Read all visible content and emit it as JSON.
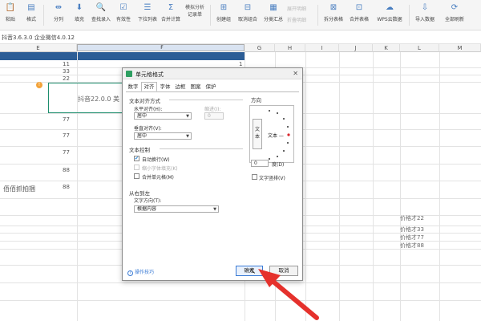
{
  "ribbon": {
    "buttons": [
      {
        "label": "粘贴",
        "icon": "paste-icon"
      },
      {
        "label": "格式",
        "icon": "format-icon"
      },
      {
        "label": "分列",
        "icon": "split-column-icon"
      },
      {
        "label": "填充",
        "icon": "fill-icon"
      },
      {
        "label": "查找录入",
        "icon": "find-entry-icon"
      },
      {
        "label": "有效性",
        "icon": "validity-icon"
      },
      {
        "label": "下拉列表",
        "icon": "dropdown-list-icon"
      },
      {
        "label": "合并计算",
        "icon": "merge-calc-icon"
      },
      {
        "label": "记录单",
        "icon": "record-form-icon"
      },
      {
        "label": "创建组",
        "icon": "create-group-icon"
      },
      {
        "label": "取消组合",
        "icon": "ungroup-icon"
      },
      {
        "label": "分类汇总",
        "icon": "subtotal-icon"
      },
      {
        "label": "拆分表格",
        "icon": "split-table-icon"
      },
      {
        "label": "合并表格",
        "icon": "merge-table-icon"
      },
      {
        "label": "WPS云数据",
        "icon": "cloud-data-icon"
      },
      {
        "label": "导入数据",
        "icon": "import-data-icon"
      },
      {
        "label": "全部刷新",
        "icon": "refresh-icon"
      }
    ],
    "small_items": {
      "simulate": "模拟分析",
      "show_detail": "展开明细",
      "hide_detail": "折叠明细"
    }
  },
  "formula_bar": {
    "content": "抖音3.6.3.0 企业微信4.0.12"
  },
  "columns": [
    "E",
    "F",
    "G",
    "H",
    "I",
    "J",
    "K",
    "L",
    "M"
  ],
  "cells": {
    "r1": "11",
    "r2": "33",
    "r3": "22",
    "r5": "77",
    "r6": "77",
    "r7": "77",
    "r8": "88",
    "r9": "88",
    "f1": "1",
    "bottom_left": "佰佰抓拍捆",
    "selected": "抖音22.0.0 美",
    "right_cells": [
      "价格才22",
      "价格才33",
      "价格才77",
      "价格才88"
    ]
  },
  "dialog": {
    "title": "单元格格式",
    "tabs": [
      "数字",
      "对齐",
      "字体",
      "边框",
      "图案",
      "保护"
    ],
    "active_tab": "对齐",
    "text_align": {
      "group": "文本对齐方式",
      "horizontal_label": "水平对齐(H):",
      "horizontal_value": "居中",
      "indent_label": "缩进(I):",
      "indent_value": "0",
      "vertical_label": "垂直对齐(V):",
      "vertical_value": "居中"
    },
    "text_control": {
      "group": "文本控制",
      "wrap": "自动换行(W)",
      "shrink": "缩小字体填充(K)",
      "merge": "合并单元格(M)"
    },
    "direction": {
      "group": "从右到左",
      "label": "文字方向(T):",
      "value": "根据内容"
    },
    "orientation": {
      "group": "方向",
      "vertical_text": "文本",
      "horizontal_text": "文本 —",
      "degrees": "0",
      "degrees_label": "度(D)",
      "stack_label": "文字竖排(V)"
    },
    "tip": "操作技巧",
    "ok": "确定",
    "cancel": "取消"
  },
  "colors": {
    "accent": "#2c5d96",
    "selection_border": "#1e8e6e",
    "arrow": "#e5312c",
    "dialog_icon": "#2d9f61"
  }
}
